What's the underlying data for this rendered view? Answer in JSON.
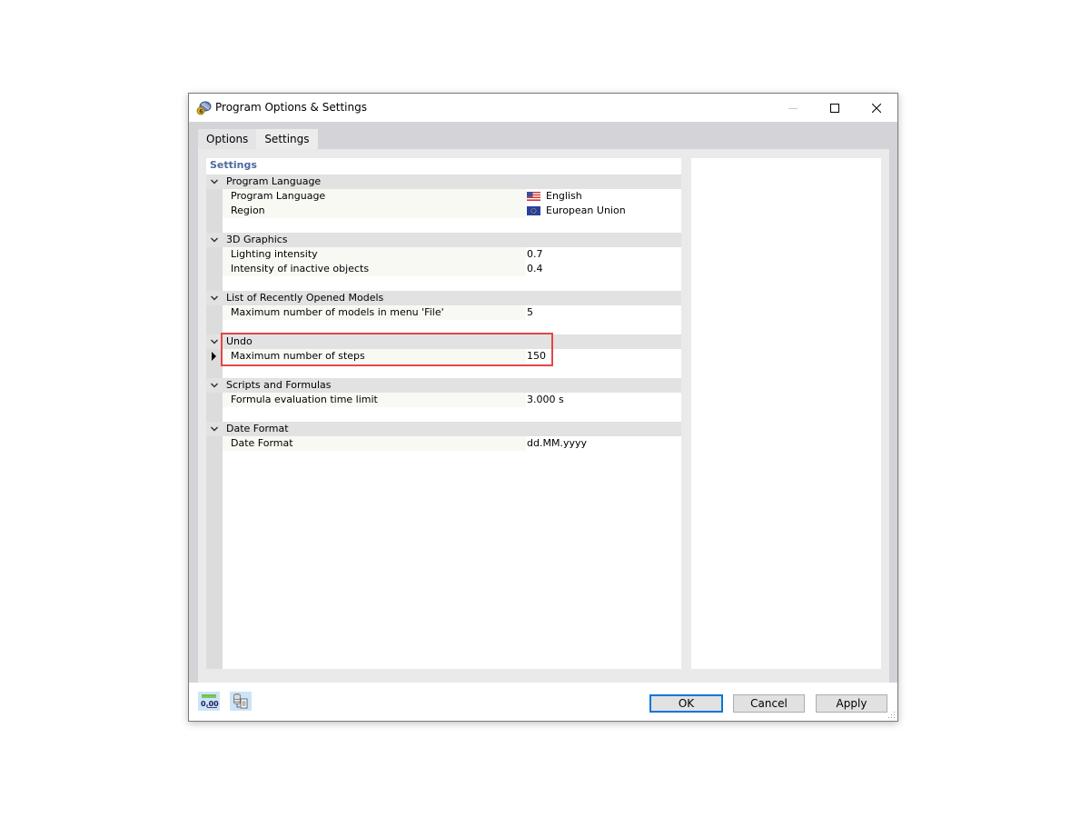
{
  "window": {
    "title": "Program Options & Settings",
    "app_icon": "app-gear-icon",
    "controls": {
      "minimize": "minimize-icon",
      "maximize": "maximize-icon",
      "close": "close-icon"
    }
  },
  "tabs": [
    {
      "label": "Options",
      "active": false
    },
    {
      "label": "Settings",
      "active": true
    }
  ],
  "tree": {
    "header": "Settings",
    "groups": [
      {
        "label": "Program Language",
        "expanded": true,
        "properties": [
          {
            "label": "Program Language",
            "value": "English",
            "icon": "us-flag-icon"
          },
          {
            "label": "Region",
            "value": "European Union",
            "icon": "eu-flag-icon"
          }
        ]
      },
      {
        "label": "3D Graphics",
        "expanded": true,
        "properties": [
          {
            "label": "Lighting intensity",
            "value": "0.7"
          },
          {
            "label": "Intensity of inactive objects",
            "value": "0.4"
          }
        ]
      },
      {
        "label": "List of Recently Opened Models",
        "expanded": true,
        "properties": [
          {
            "label": "Maximum number of models in menu 'File'",
            "value": "5"
          }
        ]
      },
      {
        "label": "Undo",
        "expanded": true,
        "highlighted": true,
        "properties": [
          {
            "label": "Maximum number of steps",
            "value": "150",
            "selected": true
          }
        ]
      },
      {
        "label": "Scripts and Formulas",
        "expanded": true,
        "properties": [
          {
            "label": "Formula evaluation time limit",
            "value": "3.000 s"
          }
        ]
      },
      {
        "label": "Date Format",
        "expanded": true,
        "properties": [
          {
            "label": "Date Format",
            "value": "dd.MM.yyyy"
          }
        ]
      }
    ]
  },
  "footer": {
    "tools": [
      {
        "icon": "decimal-places-icon",
        "text": "0,00"
      },
      {
        "icon": "database-document-icon"
      }
    ],
    "buttons": {
      "ok": "OK",
      "cancel": "Cancel",
      "apply": "Apply"
    }
  },
  "colors": {
    "accent": "#0078d7",
    "highlight_border": "#e04848",
    "header_text": "#4d6aa0",
    "group_bg": "#e2e2e2"
  }
}
